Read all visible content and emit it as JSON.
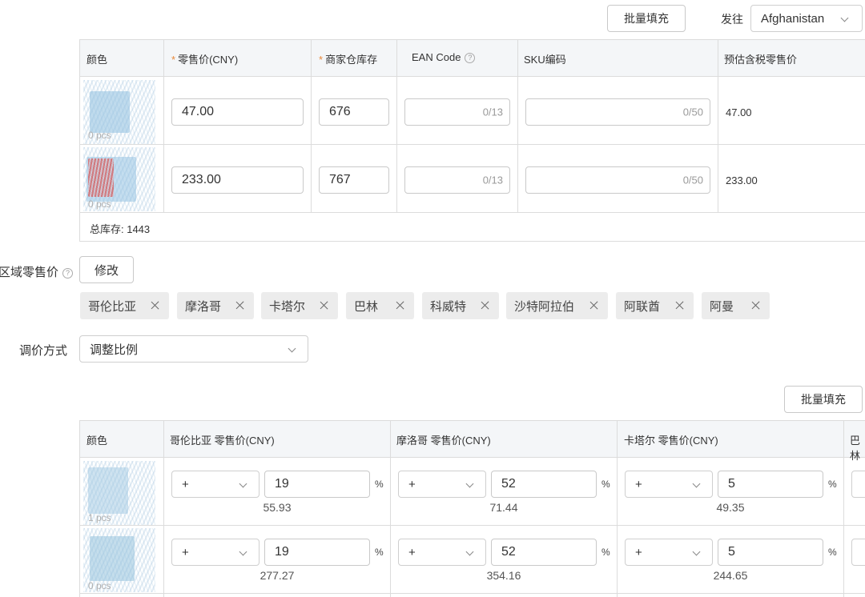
{
  "top": {
    "batch_fill": "批量填充",
    "ship_to_label": "发往",
    "ship_to_value": "Afghanistan"
  },
  "sku_table": {
    "headers": {
      "color": "颜色",
      "price": "零售价(CNY)",
      "stock": "商家仓库存",
      "ean": "EAN Code",
      "sku": "SKU编码",
      "est": "预估含税零售价"
    },
    "rows": [
      {
        "pcs": "0 pcs",
        "price": "47.00",
        "stock": "676",
        "ean_count": "0/13",
        "sku_count": "0/50",
        "est": "47.00"
      },
      {
        "pcs": "0 pcs",
        "price": "233.00",
        "stock": "767",
        "ean_count": "0/13",
        "sku_count": "0/50",
        "est": "233.00"
      }
    ],
    "total": "总库存: 1443"
  },
  "region": {
    "label": "区域零售价",
    "modify": "修改",
    "tags": [
      "哥伦比亚",
      "摩洛哥",
      "卡塔尔",
      "巴林",
      "科威特",
      "沙特阿拉伯",
      "阿联酋",
      "阿曼"
    ]
  },
  "adjust": {
    "label": "调价方式",
    "value": "调整比例"
  },
  "region_table": {
    "batch_fill": "批量填充",
    "headers": {
      "color": "颜色",
      "c1": "哥伦比亚 零售价(CNY)",
      "c2": "摩洛哥 零售价(CNY)",
      "c3": "卡塔尔 零售价(CNY)",
      "c4": "巴林"
    },
    "percent": "%",
    "rows": [
      {
        "pcs": "1 pcs",
        "cells": [
          {
            "op": "+",
            "val": "19",
            "result": "55.93"
          },
          {
            "op": "+",
            "val": "52",
            "result": "71.44"
          },
          {
            "op": "+",
            "val": "5",
            "result": "49.35"
          }
        ]
      },
      {
        "pcs": "0 pcs",
        "cells": [
          {
            "op": "+",
            "val": "19",
            "result": "277.27"
          },
          {
            "op": "+",
            "val": "52",
            "result": "354.16"
          },
          {
            "op": "+",
            "val": "5",
            "result": "244.65"
          }
        ]
      }
    ]
  }
}
